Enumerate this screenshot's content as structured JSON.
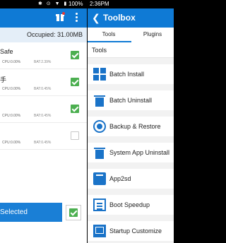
{
  "statusbar": {
    "battery": "100%",
    "time": "2:36PM"
  },
  "left": {
    "occupied": "Occupied: 31.00MB",
    "apps": [
      {
        "name": "Safe",
        "cpu": "CPU:0.00%",
        "bat": "BAT:2.39%",
        "checked": true
      },
      {
        "name": "手",
        "cpu": "CPU:0.00%",
        "bat": "BAT:0.45%",
        "checked": true
      },
      {
        "name": "",
        "cpu": "CPU:0.00%",
        "bat": "BAT:0.45%",
        "checked": true
      },
      {
        "name": "",
        "cpu": "CPU:0.00%",
        "bat": "BAT:0.45%",
        "checked": false
      }
    ],
    "selected_label": "Selected"
  },
  "right": {
    "title": "Toolbox",
    "tabs": [
      "Tools",
      "Plugins"
    ],
    "section": "Tools",
    "tools": [
      {
        "label": "Batch Install",
        "icon": "grid-icon"
      },
      {
        "label": "Batch Uninstall",
        "icon": "trash-icon"
      },
      {
        "label": "Backup & Restore",
        "icon": "backup-icon"
      },
      {
        "label": "System App Uninstall",
        "icon": "system-trash-icon"
      },
      {
        "label": "App2sd",
        "icon": "sd-card-icon"
      },
      {
        "label": "Boot Speedup",
        "icon": "boot-icon"
      },
      {
        "label": "Startup Customize",
        "icon": "startup-icon"
      }
    ]
  },
  "colors": {
    "accent": "#0f7ad5",
    "check": "#4caf50"
  }
}
